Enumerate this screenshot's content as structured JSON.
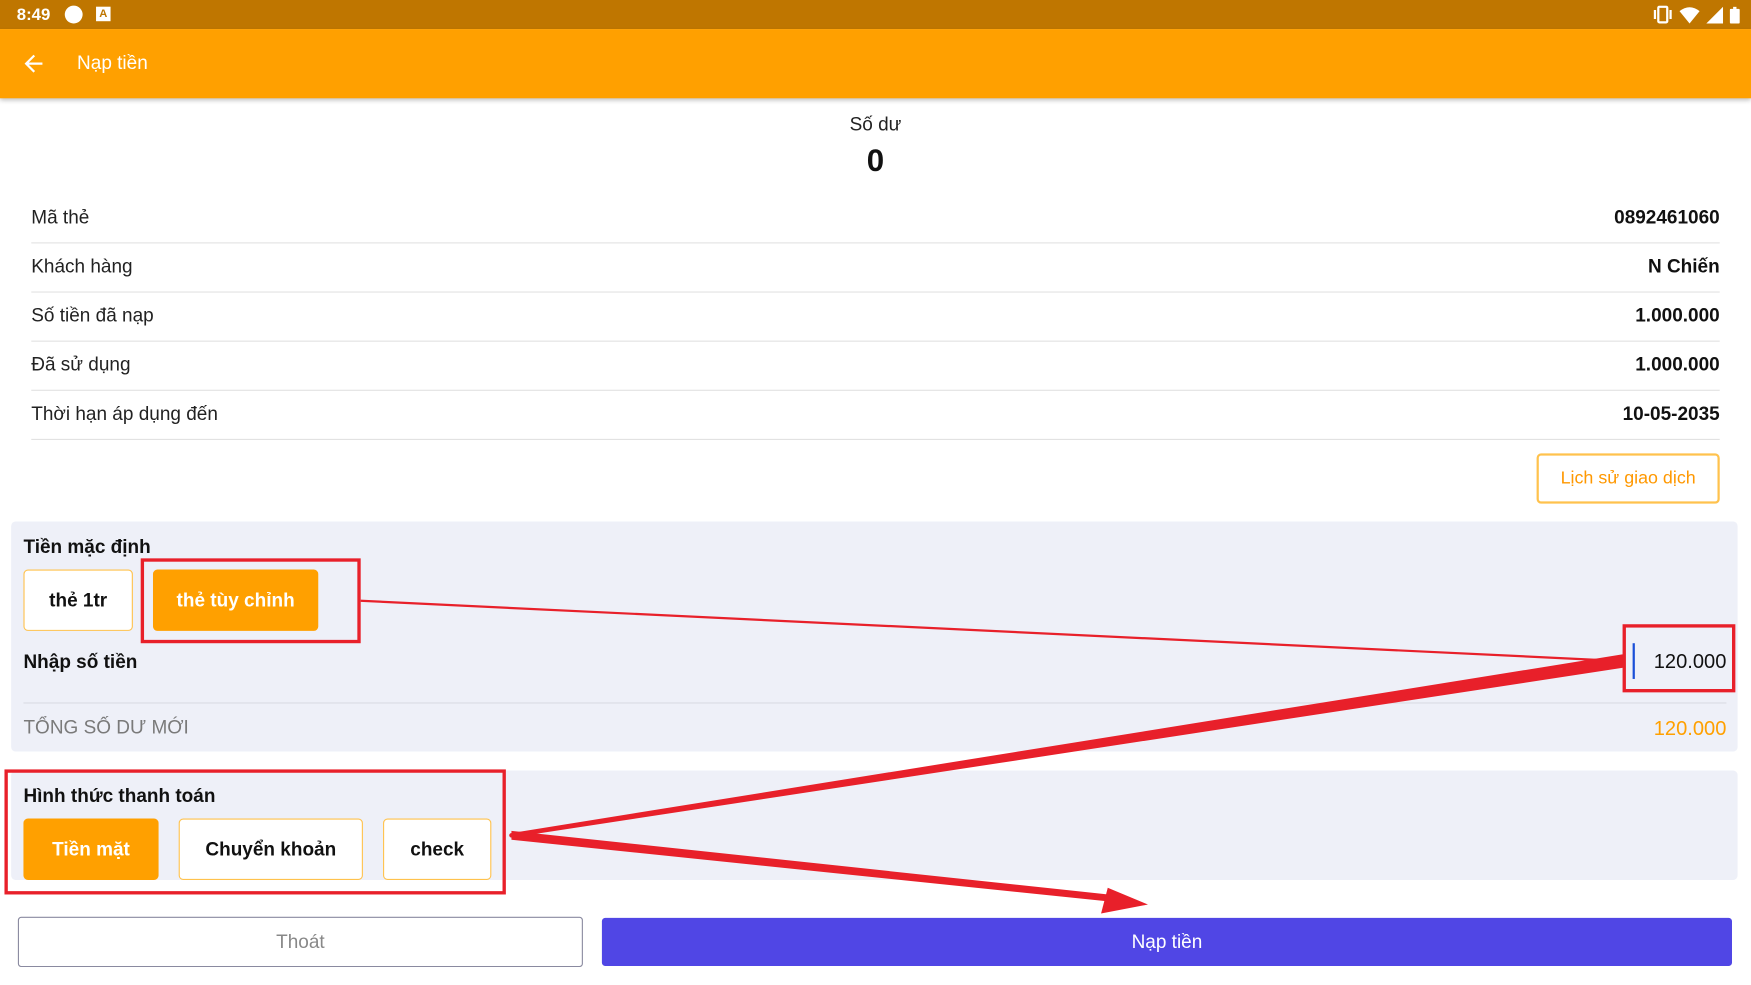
{
  "status_bar": {
    "time": "8:49",
    "a_badge": "A"
  },
  "app_bar": {
    "title": "Nạp tiền",
    "back_icon": "arrow-left-icon"
  },
  "balance": {
    "label": "Số dư",
    "value": "0"
  },
  "info_rows": [
    {
      "label": "Mã thẻ",
      "value": "0892461060"
    },
    {
      "label": "Khách hàng",
      "value": "N Chiến"
    },
    {
      "label": "Số tiền đã nạp",
      "value": "1.000.000"
    },
    {
      "label": "Đã sử dụng",
      "value": "1.000.000"
    },
    {
      "label": "Thời hạn áp dụng đến",
      "value": "10-05-2035"
    }
  ],
  "history_button": "Lịch sử giao dịch",
  "default_amount": {
    "title": "Tiền mặc định",
    "options": [
      {
        "label": "thẻ 1tr",
        "selected": false
      },
      {
        "label": "thẻ tùy chỉnh",
        "selected": true
      }
    ]
  },
  "amount_input": {
    "label": "Nhập số tiền",
    "value": "120.000"
  },
  "total": {
    "label": "TỔNG SỐ DƯ MỚI",
    "value": "120.000"
  },
  "payment": {
    "title": "Hình thức thanh toán",
    "options": [
      {
        "label": "Tiền mặt",
        "selected": true
      },
      {
        "label": "Chuyển khoản",
        "selected": false
      },
      {
        "label": "check",
        "selected": false
      }
    ]
  },
  "actions": {
    "exit": "Thoát",
    "submit": "Nạp tiền"
  },
  "colors": {
    "accent": "#ffa000",
    "status_bar": "#bf7600",
    "primary": "#5046e5",
    "annotation": "#e8202a"
  }
}
